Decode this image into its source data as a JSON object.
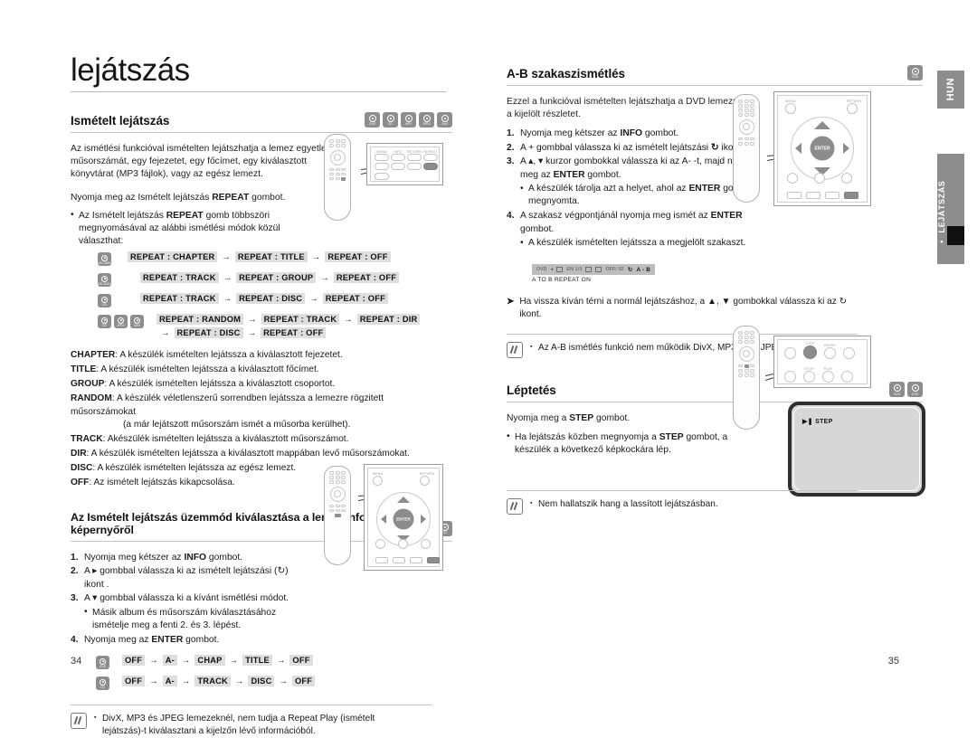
{
  "document": {
    "chapter_title": "lejátszás",
    "language_tab": "HUN",
    "side_tab": "LEJÁTSZÁS",
    "page_left": "34",
    "page_right": "35"
  },
  "badges": {
    "dvd": "DVD",
    "dvd_video": "DVD-VIDEO",
    "dvd_audio": "DVD-AUDIO",
    "cd": "CD",
    "mp3": "MP3",
    "jpeg": "JPEG",
    "divx": "DivX"
  },
  "section_repeat": {
    "heading": "Ismételt lejátszás",
    "badges": [
      "DVD",
      "CD",
      "MP3",
      "JPEG",
      "DivX"
    ],
    "intro": "Az ismétlési funkcióval ismételten lejátszhatja a lemez egyetlen műsorszámát, egy fejezetet, egy főcímet, egy kiválasztott könyvtárat (MP3 fájlok), vagy az egész lemezt.",
    "press": "Nyomja meg az Ismételt lejátszás REPEAT gombot.",
    "press_bold": "REPEAT",
    "bullet": "Az Ismételt lejátszás REPEAT gomb többszöri megnyomásával az alábbi ismétlési módok közül választhat:",
    "sequences": [
      {
        "icons": [
          "DVD-VIDEO"
        ],
        "chips": [
          "REPEAT : CHAPTER",
          "REPEAT : TITLE",
          "REPEAT : OFF"
        ]
      },
      {
        "icons": [
          "DVD-AUDIO"
        ],
        "chips": [
          "REPEAT : TRACK",
          "REPEAT : GROUP",
          "REPEAT : OFF"
        ]
      },
      {
        "icons": [
          "CD"
        ],
        "chips": [
          "REPEAT : TRACK",
          "REPEAT : DISC",
          "REPEAT : OFF"
        ]
      },
      {
        "icons": [
          "CD",
          "JPEG",
          "DivX"
        ],
        "chips": [
          "REPEAT : RANDOM",
          "REPEAT : TRACK",
          "REPEAT : DIR"
        ],
        "chips2": [
          "REPEAT : DISC",
          "REPEAT : OFF"
        ]
      }
    ],
    "definitions": [
      {
        "term": "CHAPTER",
        "text": ": A készülék ismételten lejátssza a kiválasztott fejezetet."
      },
      {
        "term": "TITLE",
        "text": ": A készülék ismételten lejátssza a kiválasztott főcímet."
      },
      {
        "term": "GROUP",
        "text": ": A készülék ismételten lejátssza a kiválasztott csoportot."
      },
      {
        "term": "RANDOM",
        "text": ": A készülék véletlenszerű sorrendben lejátssza a lemezre rögzitett műsorszámokat",
        "sub": "(a már lejátszott műsorszám ismét a műsorba kerülhet)."
      },
      {
        "term": "TRACK",
        "text": ": Akészülék ismételten lejátssza a kiválasztott műsorszámot."
      },
      {
        "term": "DIR",
        "text": ": A készülék ismételten lejátssza a kiválasztott mappában levő műsorszámokat."
      },
      {
        "term": "DISC",
        "text": ": A készülék ismételten lejátssza az egész lemezt."
      },
      {
        "term": "OFF",
        "text": ": Az ismételt lejátszás kikapcsolása."
      }
    ]
  },
  "section_info_screen": {
    "heading": "Az Ismételt lejátszás üzemmód kiválasztása a lemez információs képernyőről",
    "badges": [
      "DVD",
      "CD"
    ],
    "steps": [
      {
        "num": "1.",
        "text": "Nyomja meg kétszer az INFO gombot.",
        "bold": "INFO"
      },
      {
        "num": "2.",
        "text": "A ► gombbal válassza ki az ismételt lejátszási (↻) ikont ."
      },
      {
        "num": "3.",
        "text": "A ▼ gombbal válassza ki a kívánt ismétlési módot.",
        "bullet": "Másik album és műsorszám kiválasztásához ismételje meg a fenti 2. és 3. lépést."
      },
      {
        "num": "4.",
        "text": "Nyomja meg az ENTER gombot.",
        "bold": "ENTER"
      }
    ],
    "sequences": [
      {
        "icons": [
          "DVD"
        ],
        "chips": [
          "OFF",
          "A-",
          "CHAP",
          "TITLE",
          "OFF"
        ]
      },
      {
        "icons": [
          "CD"
        ],
        "chips": [
          "OFF",
          "A-",
          "TRACK",
          "DISC",
          "OFF"
        ]
      }
    ],
    "note": "DivX, MP3 és JPEG lemezeknél, nem tudja a Repeat Play (ismételt lejátszás)-t kiválasztani a kijelzőn lévő információból."
  },
  "section_ab": {
    "heading": "A-B szakaszismétlés",
    "badges": [
      "DVD"
    ],
    "intro": "Ezzel a funkcióval ismételten lejátszhatja a DVD lemezről a kijelölt részletet.",
    "steps": [
      {
        "num": "1.",
        "text": "Nyomja meg kétszer az INFO gombot.",
        "bold": "INFO"
      },
      {
        "num": "2.",
        "text": "A + gombbal válassza ki az ismételt lejátszási ↻ ikont ."
      },
      {
        "num": "3.",
        "text": "A ▲, ▼ kurzor gombokkal válassza ki az A- -t, majd nyomja meg az ENTER gombot.",
        "bullet": "A készülék tárolja azt a helyet, ahol az ENTER gombot megnyomta."
      },
      {
        "num": "4.",
        "text": "A szakasz végpontjánál nyomja meg ismét az ENTER gombot.",
        "bullet": "A készülék ismételten lejátssza a megjelölt szakaszt."
      }
    ],
    "osd": {
      "items": [
        "DVD",
        "EN 1/3",
        "OFF/ 02"
      ],
      "ab_label": "A - B",
      "caption": "A TO B REPEAT ON"
    },
    "tip": "Ha vissza kíván térni a normál lejátszáshoz, a ▲, ▼ gombokkal válassza ki az ↻ ikont.",
    "note": "Az A-B ismétlés funkció nem működik DivX, MP3 vagy JPEG lemezeknél."
  },
  "section_step": {
    "heading": "Léptetés",
    "badges": [
      "DVD",
      "DVD"
    ],
    "press": "Nyomja meg a STEP gombot.",
    "press_bold": "STEP",
    "bullet": "Ha lejátszás közben megnyomja a STEP gombot, a készülék a következő képkockára lép.",
    "tv_osd": "STEP",
    "note": "Nem hallatszik hang a lassított lejátszásban."
  },
  "panel_labels": {
    "menu": "MENU",
    "return": "RETURN",
    "enter": "ENTER",
    "step": "STEP",
    "pause": "PAUSE",
    "stop": "STOP",
    "play": "PLAY",
    "repeat": "REPEAT",
    "info": "INFO"
  }
}
